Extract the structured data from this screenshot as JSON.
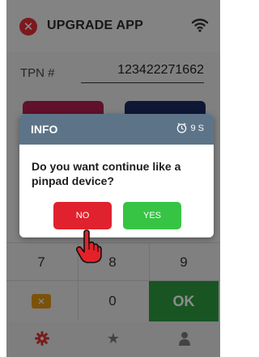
{
  "app": {
    "title": "UPGRADE APP",
    "close_glyph": "✕",
    "icons": {
      "close": "close-icon",
      "status": "wifi-icon"
    }
  },
  "form": {
    "tpn_label": "TPN #",
    "tpn_value": "123422271662"
  },
  "keypad": {
    "keys": [
      "7",
      "8",
      "9",
      "0",
      "OK"
    ],
    "delete_icon": "backspace-icon",
    "ok_color": "#2f9c41"
  },
  "bottom_nav": {
    "items": [
      {
        "icon": "gear-icon",
        "active": true,
        "color": "#d9342f"
      },
      {
        "icon": "star-icon",
        "active": false
      },
      {
        "icon": "user-icon",
        "active": false
      }
    ]
  },
  "dialog": {
    "title": "INFO",
    "timer_text": "9 S",
    "message": "Do you want continue like a pinpad device?",
    "no_label": "NO",
    "yes_label": "YES",
    "header_color": "#5d7488",
    "no_color": "#e0222e",
    "yes_color": "#37c444"
  }
}
